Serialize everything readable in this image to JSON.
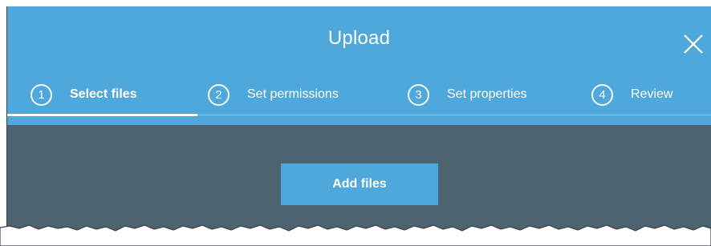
{
  "dialog": {
    "title": "Upload",
    "close_icon": "close-icon"
  },
  "steps": [
    {
      "number": "1",
      "label": "Select files",
      "active": true
    },
    {
      "number": "2",
      "label": "Set permissions",
      "active": false
    },
    {
      "number": "3",
      "label": "Set properties",
      "active": false
    },
    {
      "number": "4",
      "label": "Review",
      "active": false
    }
  ],
  "body": {
    "add_files_label": "Add files"
  },
  "colors": {
    "header": "#4fa8dc",
    "body": "#4e6370",
    "button": "#4fa8dc",
    "text": "#ffffff"
  }
}
